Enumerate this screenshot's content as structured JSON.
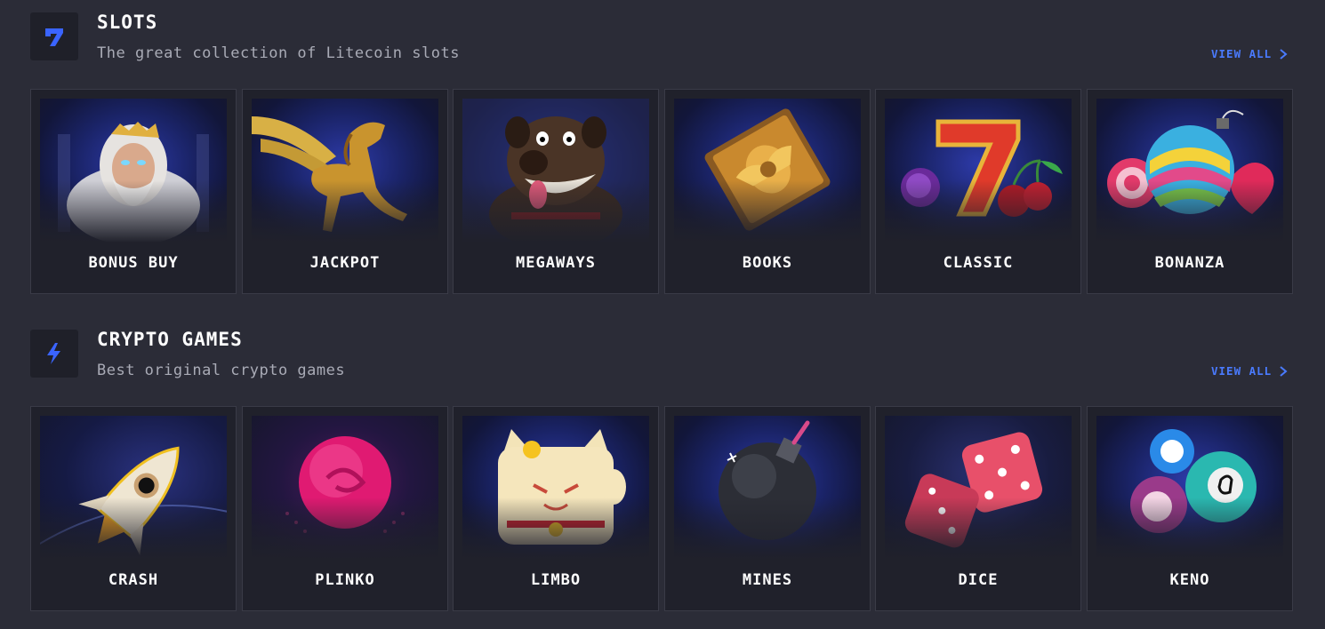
{
  "sections": {
    "slots": {
      "icon": "seven-icon",
      "title": "SLOTS",
      "subtitle": "The great collection of Litecoin slots",
      "view_all": "VIEW ALL",
      "cards": [
        {
          "label": "BONUS BUY",
          "art": "zeus-icon"
        },
        {
          "label": "JACKPOT",
          "art": "pegasus-icon"
        },
        {
          "label": "MEGAWAYS",
          "art": "dog-icon"
        },
        {
          "label": "BOOKS",
          "art": "book-icon"
        },
        {
          "label": "CLASSIC",
          "art": "lucky-seven-icon"
        },
        {
          "label": "BONANZA",
          "art": "candy-icon"
        }
      ]
    },
    "crypto": {
      "icon": "lightning-icon",
      "title": "CRYPTO GAMES",
      "subtitle": "Best original crypto games",
      "view_all": "VIEW ALL",
      "cards": [
        {
          "label": "CRASH",
          "art": "rocket-icon"
        },
        {
          "label": "PLINKO",
          "art": "ball-icon"
        },
        {
          "label": "LIMBO",
          "art": "lucky-cat-icon"
        },
        {
          "label": "MINES",
          "art": "bomb-icon"
        },
        {
          "label": "DICE",
          "art": "dice-icon"
        },
        {
          "label": "KENO",
          "art": "keno-balls-icon"
        }
      ]
    }
  },
  "colors": {
    "background": "#2b2c37",
    "card": "#20212b",
    "accent": "#4a7bff",
    "subtitle": "#a9abb6"
  }
}
